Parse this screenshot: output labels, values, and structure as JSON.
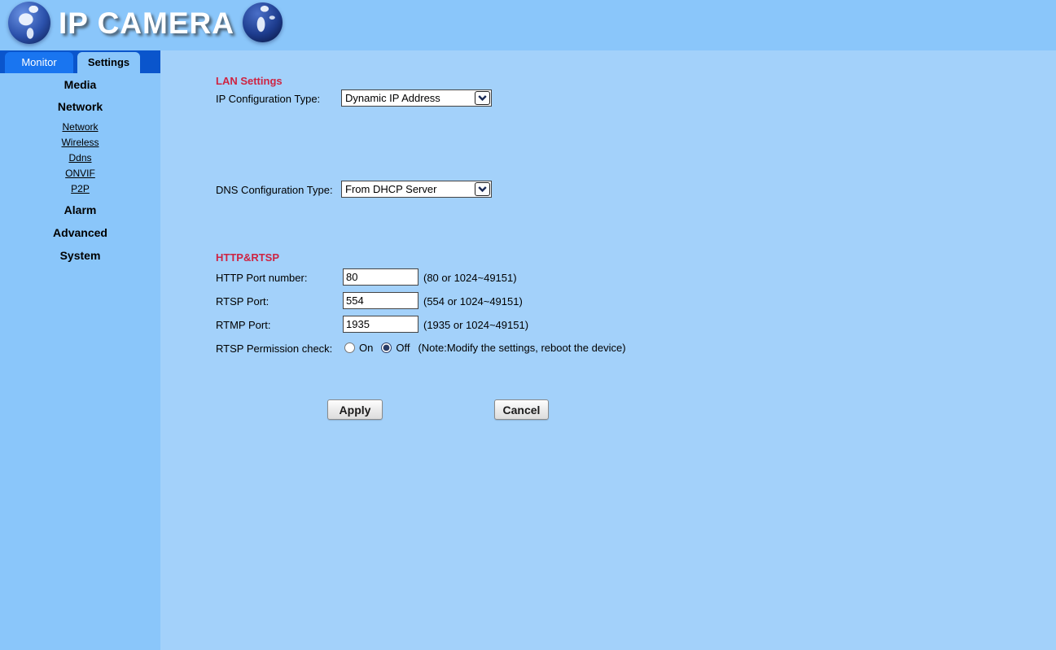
{
  "header": {
    "title": "IP CAMERA"
  },
  "tabs": [
    {
      "label": "Monitor",
      "active": false
    },
    {
      "label": "Settings",
      "active": true
    }
  ],
  "sidebar": {
    "items": [
      {
        "label": "Media",
        "type": "heading"
      },
      {
        "label": "Network",
        "type": "heading"
      },
      {
        "label": "Network",
        "type": "link"
      },
      {
        "label": "Wireless",
        "type": "link"
      },
      {
        "label": "Ddns",
        "type": "link"
      },
      {
        "label": "ONVIF",
        "type": "link"
      },
      {
        "label": "P2P",
        "type": "link"
      },
      {
        "label": "Alarm",
        "type": "heading"
      },
      {
        "label": "Advanced",
        "type": "heading"
      },
      {
        "label": "System",
        "type": "heading"
      }
    ]
  },
  "main": {
    "lan_settings": {
      "heading": "LAN Settings",
      "ip_config": {
        "label": "IP Configuration Type:",
        "value": "Dynamic IP Address"
      },
      "dns_config": {
        "label": "DNS Configuration Type:",
        "value": "From DHCP Server"
      }
    },
    "http_rtsp": {
      "heading": "HTTP&RTSP",
      "http_port": {
        "label": "HTTP Port number:",
        "value": "80",
        "hint": "(80 or 1024~49151)"
      },
      "rtsp_port": {
        "label": "RTSP Port:",
        "value": "554",
        "hint": "(554 or 1024~49151)"
      },
      "rtmp_port": {
        "label": "RTMP Port:",
        "value": "1935",
        "hint": "(1935 or 1024~49151)"
      },
      "rtsp_permission": {
        "label": "RTSP Permission check:",
        "options": [
          {
            "label": "On",
            "selected": false
          },
          {
            "label": "Off",
            "selected": true
          }
        ],
        "note": "(Note:Modify the settings, reboot the device)"
      }
    },
    "buttons": {
      "apply": "Apply",
      "cancel": "Cancel"
    }
  },
  "colors": {
    "header_bg": "#8ac6fa",
    "main_bg": "#a3d1fa",
    "tabbar_bg": "#0a55cc",
    "monitor_tab_bg": "#1975f0",
    "section_heading": "#ce2442"
  }
}
